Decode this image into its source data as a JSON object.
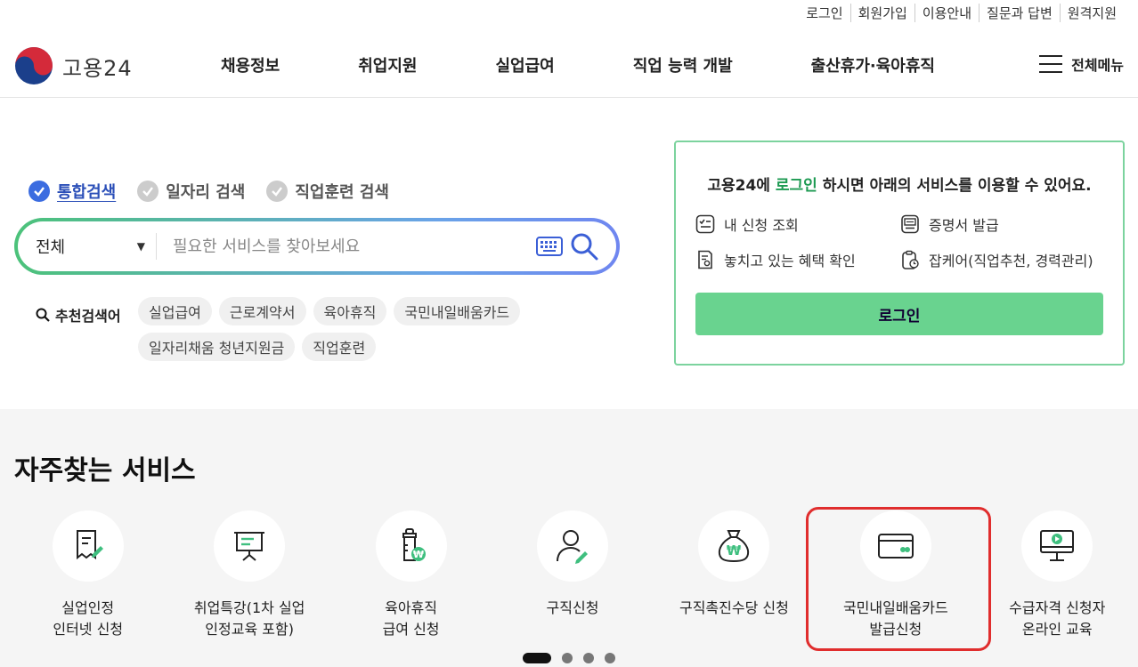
{
  "topbar": [
    "로그인",
    "회원가입",
    "이용안내",
    "질문과 답변",
    "원격지원"
  ],
  "logo": {
    "text": "고용24"
  },
  "gnb": [
    "채용정보",
    "취업지원",
    "실업급여",
    "직업 능력 개발",
    "출산휴가·육아휴직"
  ],
  "allmenu": "전체메뉴",
  "search": {
    "tabs": [
      {
        "label": "통합검색",
        "active": true
      },
      {
        "label": "일자리 검색",
        "active": false
      },
      {
        "label": "직업훈련 검색",
        "active": false
      }
    ],
    "scope": "전체",
    "placeholder": "필요한 서비스를 찾아보세요",
    "recommend_title": "추천검색어",
    "recommend": [
      "실업급여",
      "근로계약서",
      "육아휴직",
      "국민내일배움카드",
      "일자리채움 청년지원금",
      "직업훈련"
    ]
  },
  "login_panel": {
    "msg_pre": "고용24에 ",
    "msg_link": "로그인",
    "msg_post": " 하시면 아래의 서비스를 이용할 수 있어요.",
    "items": [
      "내 신청 조회",
      "증명서 발급",
      "놓치고 있는 혜택 확인",
      "잡케어(직업추천, 경력관리)"
    ],
    "button": "로그인"
  },
  "services": {
    "title": "자주찾는 서비스",
    "items": [
      "실업인정\n인터넷 신청",
      "취업특강(1차 실업\n인정교육 포함)",
      "육아휴직\n급여 신청",
      "구직신청",
      "구직촉진수당 신청",
      "국민내일배움카드\n발급신청",
      "수급자격 신청자\n온라인 교육"
    ],
    "currency_symbol": "₩"
  },
  "colors": {
    "accent": "#3b6ce0",
    "green": "#69d38f",
    "highlight": "#e02d2d"
  }
}
